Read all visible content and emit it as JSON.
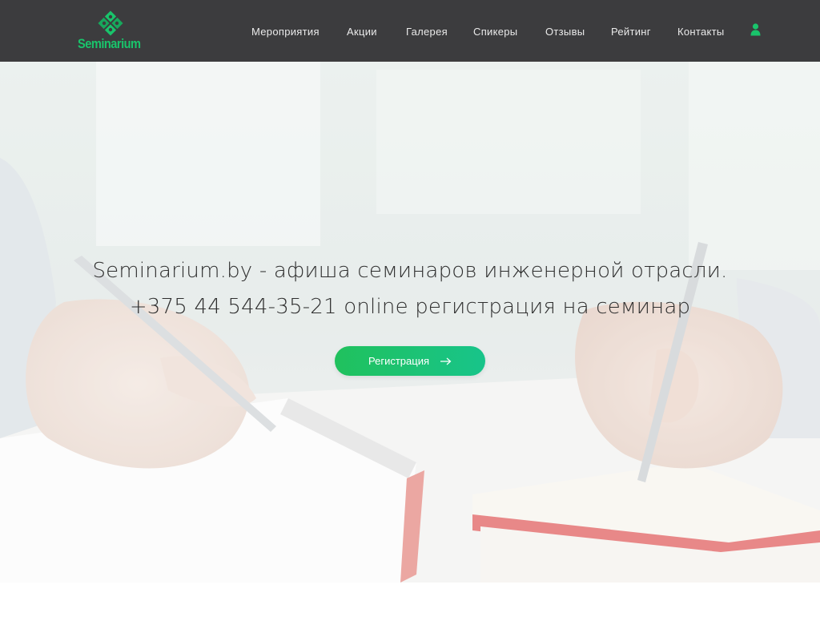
{
  "header": {
    "logo_text": "Seminarium",
    "nav": [
      {
        "label": "Мероприятия"
      },
      {
        "label": "Акции"
      },
      {
        "label": "Галерея"
      },
      {
        "label": "Спикеры"
      },
      {
        "label": "Отзывы"
      },
      {
        "label": "Рейтинг"
      },
      {
        "label": "Контакты"
      }
    ],
    "user_icon": "user-icon"
  },
  "hero": {
    "line1": "Seminarium.by - афиша семинаров инженерной отрасли.",
    "line2": "+375 44 544-35-21 online регистрация на семинар",
    "button_label": "Регистрация",
    "button_icon": "arrow-right-icon",
    "background_image": "hands writing in notebooks with pens"
  },
  "colors": {
    "header_bg": "#3c3c3e",
    "accent_green": "#19c46b",
    "nav_text": "#eaeaea",
    "hero_text": "#2e2e2e"
  }
}
